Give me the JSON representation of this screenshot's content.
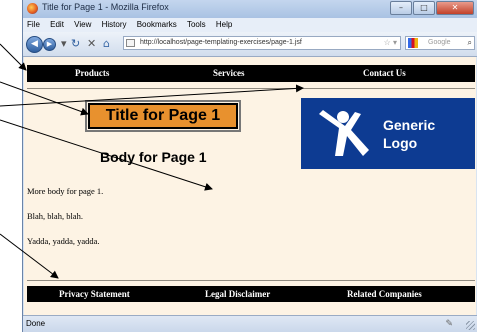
{
  "window": {
    "title": "Title for Page 1 - Mozilla Firefox",
    "controls": {
      "minimize": "–",
      "maximize": "□",
      "close": "✕"
    }
  },
  "menu": [
    "File",
    "Edit",
    "View",
    "History",
    "Bookmarks",
    "Tools",
    "Help"
  ],
  "navigation": {
    "back_icon": "back-arrow-icon",
    "forward_icon": "forward-arrow-icon",
    "reload_icon": "reload-icon",
    "stop_icon": "stop-icon",
    "home_icon": "home-icon",
    "url": "http://localhost/page-templating-exercises/page-1.jsf",
    "search_placeholder": "Google"
  },
  "page": {
    "top_nav": [
      "Products",
      "Services",
      "Contact Us"
    ],
    "title": "Title for Page 1",
    "logo": {
      "line1": "Generic",
      "line2": "Logo"
    },
    "body_title": "Body for Page 1",
    "paragraphs": [
      "More body for page 1.",
      "Blah, blah, blah.",
      "Yadda, yadda, yadda."
    ],
    "footer_nav": [
      "Privacy Statement",
      "Legal Disclaimer",
      "Related Companies"
    ]
  },
  "status": {
    "text": "Done"
  },
  "colors": {
    "title_box": "#e8912e",
    "logo_bg": "#0d3b92",
    "content_bg": "#fdf3e4",
    "nav_bg": "#000000"
  }
}
